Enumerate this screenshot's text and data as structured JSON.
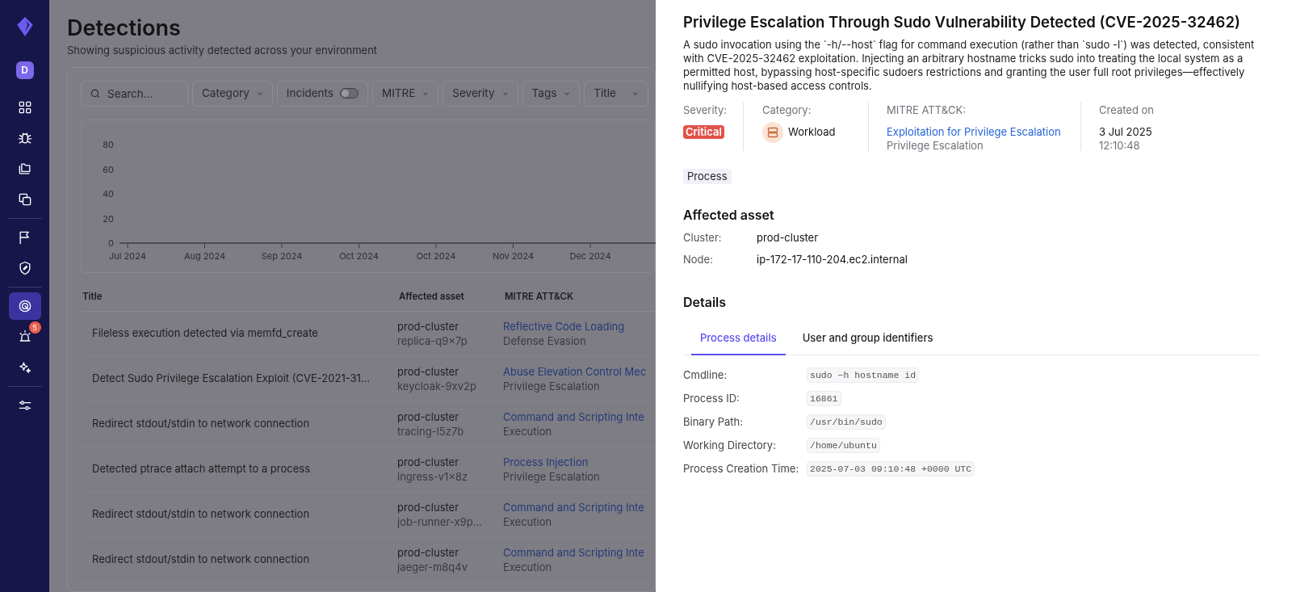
{
  "sidebar": {
    "avatar": "D",
    "items": [
      {
        "kind": "button",
        "selected": false
      },
      {
        "kind": "button",
        "selected": false
      },
      {
        "kind": "button",
        "selected": false
      },
      {
        "kind": "button",
        "selected": false
      },
      {
        "kind": "divider"
      },
      {
        "kind": "button",
        "selected": false
      },
      {
        "kind": "button",
        "selected": false
      },
      {
        "kind": "divider"
      },
      {
        "kind": "button",
        "selected": true
      },
      {
        "kind": "button",
        "selected": false,
        "badge": "5"
      },
      {
        "kind": "button",
        "selected": false
      },
      {
        "kind": "divider"
      },
      {
        "kind": "button",
        "selected": false
      }
    ]
  },
  "page": {
    "title": "Detections",
    "subtitle": "Showing suspicious activity detected across your environment"
  },
  "filters": [
    {
      "kind": "search",
      "placeholder": "Search..."
    },
    {
      "kind": "dropdown",
      "label": "Category"
    },
    {
      "kind": "toggle",
      "label": "Incidents",
      "on": false
    },
    {
      "kind": "dropdown",
      "label": "MITRE"
    },
    {
      "kind": "dropdown",
      "label": "Severity"
    },
    {
      "kind": "dropdown",
      "label": "Tags"
    },
    {
      "kind": "dropdown",
      "label": "Title"
    }
  ],
  "chart": {
    "chart_data": {
      "type": "line",
      "categories": [
        "Jul 2024",
        "Aug 2024",
        "Sep 2024",
        "Oct 2024",
        "Oct 2024",
        "Nov 2024",
        "Dec 2024"
      ],
      "yticks": [
        0,
        20,
        40,
        60,
        80
      ],
      "ylim": [
        0,
        80
      ]
    }
  },
  "table": {
    "columns": [
      "Title",
      "Affected asset",
      "MITRE ATT&CK"
    ],
    "rows": [
      {
        "title": "Fileless execution detected via memfd_create",
        "cluster": "prod-cluster",
        "asset": "replica-q9×7p",
        "technique": "Reflective Code Loading",
        "tactic": "Defense Evasion"
      },
      {
        "title": "Detect Sudo Privilege Escalation Exploit (CVE-2021-31...",
        "cluster": "prod-cluster",
        "asset": "keycloak-9xv2p",
        "technique": "Abuse Elevation Control Mec",
        "tactic": "Privilege Escalation"
      },
      {
        "title": "Redirect stdout/stdin to network connection",
        "cluster": "prod-cluster",
        "asset": "tracing-l5z7b",
        "technique": "Command and Scripting Inte",
        "tactic": "Execution"
      },
      {
        "title": "Detected ptrace attach attempt to a process",
        "cluster": "prod-cluster",
        "asset": "ingress-v1×8z",
        "technique": "Process Injection",
        "tactic": "Privilege Escalation"
      },
      {
        "title": "Redirect stdout/stdin to network connection",
        "cluster": "prod-cluster",
        "asset": "job-runner-x9p...",
        "technique": "Command and Scripting Inte",
        "tactic": "Execution"
      },
      {
        "title": "Redirect stdout/stdin to network connection",
        "cluster": "prod-cluster",
        "asset": "jaeger-m8q4v",
        "technique": "Command and Scripting Inte",
        "tactic": "Execution"
      }
    ]
  },
  "detail": {
    "title": "Privilege Escalation Through Sudo Vulnerability Detected (CVE-2025-32462)",
    "description": "A sudo invocation using the `-h/--host` flag for command execution (rather than `sudo -l`) was detected, consistent with CVE-2025-32462 exploitation. Injecting an arbitrary hostname tricks sudo into treating the local system as a permitted host, bypassing host-specific sudoers restrictions and granting the user full root privileges—effectively nullifying host-based access controls.",
    "severity_label": "Severity:",
    "severity": "Critical",
    "category_label": "Category:",
    "category": "Workload",
    "mitre_label": "MITRE ATT&CK:",
    "mitre_technique": "Exploitation for Privilege Escalation",
    "mitre_tactic": "Privilege Escalation",
    "created_label": "Created on",
    "created_date": "3 Jul 2025",
    "created_time": "12:10:48",
    "tags": [
      "Process"
    ],
    "asset_heading": "Affected asset",
    "asset_fields": [
      {
        "label": "Cluster:",
        "value": "prod-cluster"
      },
      {
        "label": "Node:",
        "value": "ip-172-17-110-204.ec2.internal"
      }
    ],
    "details_heading": "Details",
    "tabs": [
      {
        "label": "Process details",
        "selected": true
      },
      {
        "label": "User and group identifiers",
        "selected": false
      }
    ],
    "fields": [
      {
        "label": "Cmdline:",
        "value": "sudo −h hostname id"
      },
      {
        "label": "Process ID:",
        "value": "16861"
      },
      {
        "label": "Binary Path:",
        "value": "/usr/bin/sudo"
      },
      {
        "label": "Working Directory:",
        "value": "/home/ubuntu"
      },
      {
        "label": "Process Creation Time:",
        "value": "2025-07-03 09:10:48 +0000 UTC"
      }
    ]
  }
}
